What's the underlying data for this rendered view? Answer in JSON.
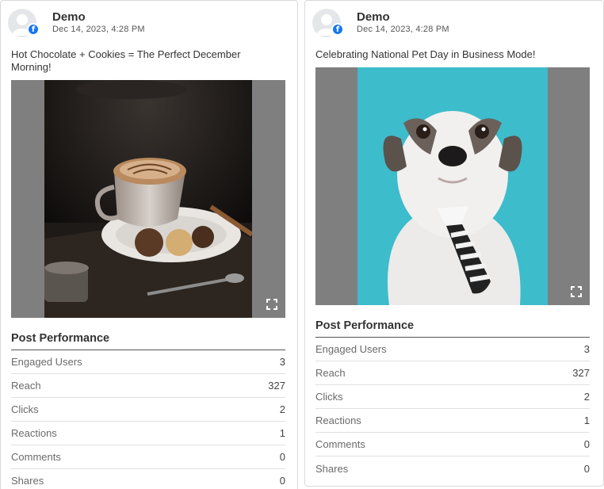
{
  "posts": [
    {
      "author": "Demo",
      "timestamp": "Dec 14, 2023, 4:28 PM",
      "caption": "Hot Chocolate + Cookies = The Perfect December Morning!",
      "section_title": "Post Performance",
      "metrics": [
        {
          "label": "Engaged Users",
          "value": "3"
        },
        {
          "label": "Reach",
          "value": "327"
        },
        {
          "label": "Clicks",
          "value": "2"
        },
        {
          "label": "Reactions",
          "value": "1"
        },
        {
          "label": "Comments",
          "value": "0"
        },
        {
          "label": "Shares",
          "value": "0"
        }
      ]
    },
    {
      "author": "Demo",
      "timestamp": "Dec 14, 2023, 4:28 PM",
      "caption": "Celebrating National Pet Day in Business Mode!",
      "section_title": "Post Performance",
      "metrics": [
        {
          "label": "Engaged Users",
          "value": "3"
        },
        {
          "label": "Reach",
          "value": "327"
        },
        {
          "label": "Clicks",
          "value": "2"
        },
        {
          "label": "Reactions",
          "value": "1"
        },
        {
          "label": "Comments",
          "value": "0"
        },
        {
          "label": "Shares",
          "value": "0"
        }
      ]
    }
  ],
  "icons": {
    "platform": "facebook-icon",
    "avatar": "user-avatar-icon",
    "expand": "expand-icon"
  },
  "colors": {
    "facebook": "#1877f2",
    "media_letterbox": "#7f7f7f",
    "pet_background": "#3dbccb"
  }
}
